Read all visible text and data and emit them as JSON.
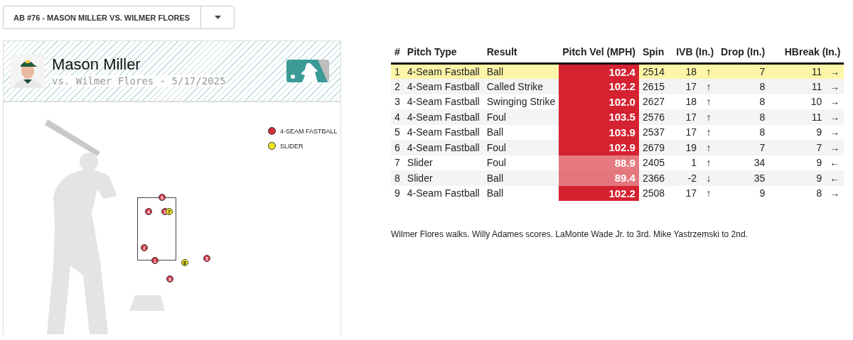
{
  "at_bat_select": {
    "value": "AB #76 - MASON MILLER VS. WILMER FLORES"
  },
  "card": {
    "pitcher": "Mason Miller",
    "matchup": "vs. Wilmer Flores - 5/17/2025",
    "legend": [
      {
        "label": "4-SEAM FASTBALL",
        "color": "#d62b3e"
      },
      {
        "label": "SLIDER",
        "color": "#f2e21e"
      }
    ],
    "pitches": [
      {
        "label": "6",
        "color": "#d62b3e"
      },
      {
        "label": "4",
        "color": "#d62b3e"
      },
      {
        "label": "3",
        "color": "#d62b3e"
      },
      {
        "label": "7",
        "color": "#f2e21e"
      },
      {
        "label": "2",
        "color": "#d62b3e"
      },
      {
        "label": "5",
        "color": "#d62b3e"
      },
      {
        "label": "1",
        "color": "#d62b3e"
      },
      {
        "label": "8",
        "color": "#f2e21e"
      },
      {
        "label": "9",
        "color": "#d62b3e"
      }
    ]
  },
  "table": {
    "columns": [
      "#",
      "Pitch Type",
      "Result",
      "Pitch Vel (MPH)",
      "Spin",
      "IVB (In.)",
      "Drop (In.)",
      "HBreak (In.)"
    ],
    "rows": [
      {
        "selected": true,
        "num": "1",
        "type": "4-Seam Fastball",
        "result": "Ball",
        "vel": "102.4",
        "color": "#d52230",
        "spin": "2514",
        "ivb": "18",
        "ivb_arrow": "↑",
        "drop": "7",
        "hbreak": "11",
        "h_arrow": "→"
      },
      {
        "selected": false,
        "num": "2",
        "type": "4-Seam Fastball",
        "result": "Called Strike",
        "vel": "102.2",
        "color": "#d52230",
        "spin": "2615",
        "ivb": "17",
        "ivb_arrow": "↑",
        "drop": "8",
        "hbreak": "11",
        "h_arrow": "→"
      },
      {
        "selected": false,
        "num": "3",
        "type": "4-Seam Fastball",
        "result": "Swinging Strike",
        "vel": "102.0",
        "color": "#d52230",
        "spin": "2627",
        "ivb": "18",
        "ivb_arrow": "↑",
        "drop": "8",
        "hbreak": "10",
        "h_arrow": "→"
      },
      {
        "selected": false,
        "num": "4",
        "type": "4-Seam Fastball",
        "result": "Foul",
        "vel": "103.5",
        "color": "#d52230",
        "spin": "2576",
        "ivb": "17",
        "ivb_arrow": "↑",
        "drop": "8",
        "hbreak": "11",
        "h_arrow": "→"
      },
      {
        "selected": false,
        "num": "5",
        "type": "4-Seam Fastball",
        "result": "Ball",
        "vel": "103.9",
        "color": "#d52230",
        "spin": "2537",
        "ivb": "17",
        "ivb_arrow": "↑",
        "drop": "8",
        "hbreak": "9",
        "h_arrow": "→"
      },
      {
        "selected": false,
        "num": "6",
        "type": "4-Seam Fastball",
        "result": "Foul",
        "vel": "102.9",
        "color": "#d52230",
        "spin": "2679",
        "ivb": "19",
        "ivb_arrow": "↑",
        "drop": "7",
        "hbreak": "7",
        "h_arrow": "→"
      },
      {
        "selected": false,
        "num": "7",
        "type": "Slider",
        "result": "Foul",
        "vel": "88.9",
        "color": "#e67a80",
        "spin": "2405",
        "ivb": "1",
        "ivb_arrow": "↑",
        "drop": "34",
        "hbreak": "9",
        "h_arrow": "←"
      },
      {
        "selected": false,
        "num": "8",
        "type": "Slider",
        "result": "Ball",
        "vel": "89.4",
        "color": "#e4767d",
        "spin": "2366",
        "ivb": "-2",
        "ivb_arrow": "↓",
        "drop": "35",
        "hbreak": "9",
        "h_arrow": "←"
      },
      {
        "selected": false,
        "num": "9",
        "type": "4-Seam Fastball",
        "result": "Ball",
        "vel": "102.2",
        "color": "#d52230",
        "spin": "2508",
        "ivb": "17",
        "ivb_arrow": "↑",
        "drop": "9",
        "hbreak": "8",
        "h_arrow": "→"
      }
    ]
  },
  "summary": "Wilmer Flores walks. Willy Adames scores. LaMonte Wade Jr. to 3rd. Mike Yastrzemski to 2nd."
}
